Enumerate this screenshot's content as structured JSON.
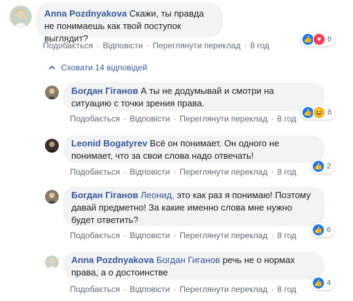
{
  "actions": {
    "like": "Подобається",
    "reply": "Відповісти",
    "translate": "Переглянути переклад",
    "separator": "·"
  },
  "hide_replies": "Сховати 14 відповідей",
  "comments": [
    {
      "author": "Anna Pozdnyakova",
      "text": "Скажи, ты правда не понимаешь как твой поступок выглядит?",
      "time": "8 год",
      "reaction_count": "6",
      "reactions": [
        "like",
        "love"
      ]
    },
    {
      "author": "Богдан Гіганов",
      "text": "А ты не додумывай и смотри на ситуацию с точки зрения права.",
      "time": "8 год",
      "reaction_count": "8",
      "reactions": [
        "like",
        "haha"
      ]
    },
    {
      "author": "Leonid Bogatyrev",
      "text": "Всё он понимает. Он одного не понимает, что за свои слова надо отвечать!",
      "time": "8 год",
      "reaction_count": "2",
      "reactions": [
        "like"
      ]
    },
    {
      "author": "Богдан Гіганов",
      "mention": "Леонид,",
      "text": "это как раз я понимаю! Поэтому давай предметно! За какие именно слова мне нужно будет ответить?",
      "time": "8 год",
      "reaction_count": "6",
      "reactions": [
        "like"
      ]
    },
    {
      "author": "Anna Pozdnyakova",
      "mention": "Богдан Гиганов",
      "text": "речь не о нормах права, а о достоинстве",
      "time": "8 год",
      "reaction_count": "4",
      "reactions": [
        "like"
      ]
    }
  ],
  "colors": {
    "link": "#385898",
    "bubble": "#f2f3f5",
    "like": "#1877f2",
    "love": "#f33e58",
    "haha": "#f7b125"
  }
}
